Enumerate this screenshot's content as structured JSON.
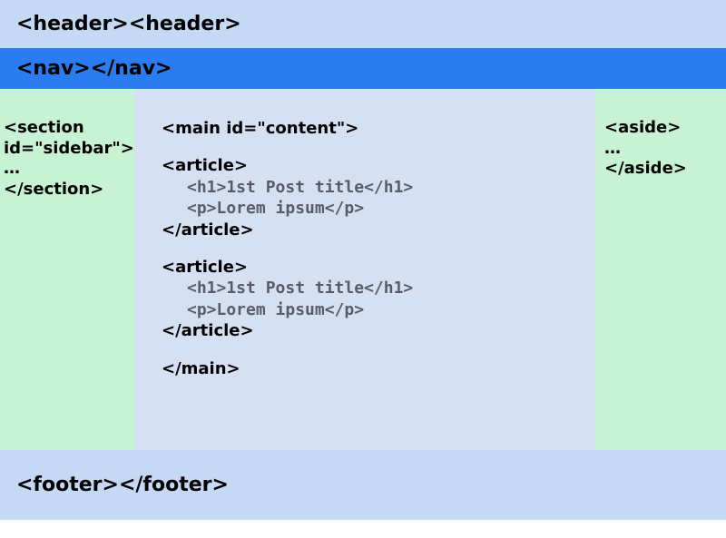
{
  "header": {
    "text": "<header><header>"
  },
  "nav": {
    "text": "<nav></nav>"
  },
  "sidebar": {
    "open": "<section id=\"sidebar\">",
    "ellipsis": "…",
    "close": "</section>"
  },
  "main": {
    "open": "<main id=\"content\">",
    "close": "</main>",
    "articles": [
      {
        "open": "<article>",
        "h1": "<h1>1st Post title</h1>",
        "p": "<p>Lorem ipsum</p>",
        "close": "</article>"
      },
      {
        "open": "<article>",
        "h1": "<h1>1st Post title</h1>",
        "p": "<p>Lorem ipsum</p>",
        "close": "</article>"
      }
    ]
  },
  "aside": {
    "open": "<aside>",
    "ellipsis": "…",
    "close": "</aside>"
  },
  "footer": {
    "text": "<footer></footer>"
  }
}
